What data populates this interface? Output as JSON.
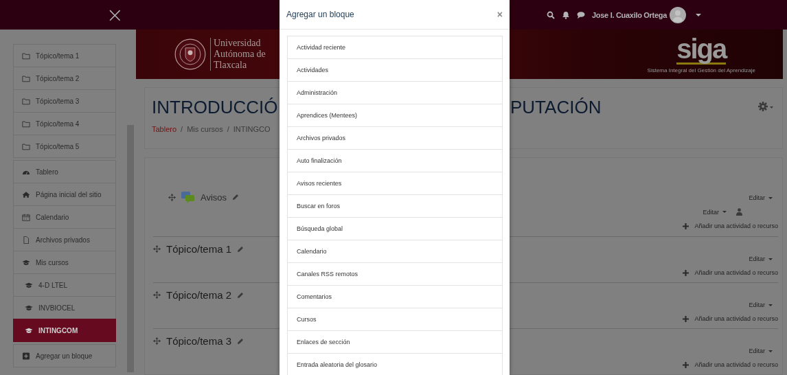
{
  "top_bar": {
    "close_label": "×",
    "user_name": "Jose I. Cuaxilo Ortega"
  },
  "sidebar": {
    "groups": [
      {
        "items": [
          {
            "label": "Tópico/tema 1",
            "kind": "folder",
            "selected": false
          },
          {
            "label": "Tópico/tema 2",
            "kind": "folder",
            "selected": false
          },
          {
            "label": "Tópico/tema 3",
            "kind": "folder",
            "selected": false
          },
          {
            "label": "Tópico/tema 4",
            "kind": "folder",
            "selected": false
          },
          {
            "label": "Tópico/tema 5",
            "kind": "folder",
            "selected": false
          }
        ]
      },
      {
        "items": [
          {
            "label": "Tablero",
            "kind": "dashboard",
            "selected": false
          },
          {
            "label": "Página inicial del sitio",
            "kind": "home",
            "selected": false
          },
          {
            "label": "Calendario",
            "kind": "calendar",
            "selected": false
          },
          {
            "label": "Archivos privados",
            "kind": "file",
            "selected": false
          },
          {
            "label": "Mis cursos",
            "kind": "cap",
            "selected": false,
            "children": [
              {
                "label": "4-D LTEL",
                "kind": "cap",
                "selected": false
              },
              {
                "label": "INVBIOCEL",
                "kind": "cap",
                "selected": false
              },
              {
                "label": "INTINGCOM",
                "kind": "cap",
                "selected": true
              }
            ]
          }
        ]
      },
      {
        "items": [
          {
            "label": "Agregar un bloque",
            "kind": "plus",
            "selected": false
          }
        ]
      }
    ]
  },
  "banner": {
    "university_lines": [
      "Universidad",
      "Autónoma de",
      "Tlaxcala"
    ],
    "siga_logo": "siga",
    "siga_tagline": "Sistema Integral del Gestión del Aprendizaje"
  },
  "header": {
    "title_left": "INTRODUCCIÓ",
    "title_right": "PUTACIÓN",
    "breadcrumb": [
      "Tablero",
      "Mis cursos",
      "INTINGCO"
    ],
    "breadcrumb_separator": "/"
  },
  "course": {
    "intro": {
      "activity": "Avisos",
      "edit_section": "Editar",
      "edit_activity": "Editar",
      "add": "Añadir una actividad o recurso"
    },
    "sections": [
      {
        "title": "Tópico/tema 1",
        "edit": "Editar",
        "add": "Añadir una actividad o recurso"
      },
      {
        "title": "Tópico/tema 2",
        "edit": "Editar",
        "add": "Añadir una actividad o recurso"
      },
      {
        "title": "Tópico/tema 3",
        "edit": "Editar",
        "add": "Añadir una actividad o recurso"
      }
    ]
  },
  "modal": {
    "title": "Agregar un bloque",
    "close": "×",
    "items": [
      "Actividad reciente",
      "Actividades",
      "Administración",
      "Aprendices (Mentees)",
      "Archivos privados",
      "Auto finalización",
      "Avisos recientes",
      "Buscar en foros",
      "Búsqueda global",
      "Calendario",
      "Canales RSS remotos",
      "Comentarios",
      "Cursos",
      "Enlaces de sección",
      "Entrada aleatoria del glosario"
    ]
  }
}
